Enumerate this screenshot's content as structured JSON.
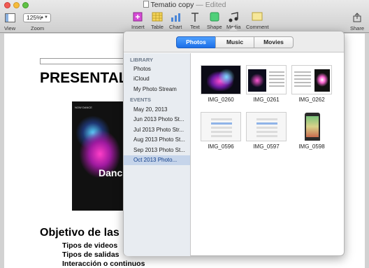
{
  "window": {
    "title": "Tematio copy",
    "status": "Edited",
    "separator": "—"
  },
  "toolbar": {
    "view_label": "View",
    "zoom_value": "125%",
    "zoom_label": "Zoom",
    "items": [
      {
        "label": "Insert",
        "icon": "insert-icon"
      },
      {
        "label": "Table",
        "icon": "table-icon"
      },
      {
        "label": "Chart",
        "icon": "chart-icon"
      },
      {
        "label": "Text",
        "icon": "text-icon"
      },
      {
        "label": "Shape",
        "icon": "shape-icon"
      },
      {
        "label": "Media",
        "icon": "media-icon"
      },
      {
        "label": "Comment",
        "icon": "comment-icon"
      }
    ],
    "share_label": "Share"
  },
  "document": {
    "title": "PRESENTAL",
    "section_title": "Objetivo de las",
    "bullets": [
      "Tipos de videos",
      "Tipos de salidas",
      "Interacción o continuos"
    ],
    "image_word": "Danc",
    "image_brand": "NOW DANCE"
  },
  "media_browser": {
    "tabs": [
      "Photos",
      "Music",
      "Movies"
    ],
    "active_tab": "Photos",
    "sections": [
      {
        "heading": "LIBRARY",
        "items": [
          "Photos",
          "iCloud",
          "My Photo Stream"
        ]
      },
      {
        "heading": "EVENTS",
        "items": [
          "May 20, 2013",
          "Jun 2013 Photo St...",
          "Jul 2013 Photo Str...",
          "Aug 2013 Photo St...",
          "Sep 2013 Photo St...",
          "Oct 2013 Photo..."
        ]
      }
    ],
    "selected_item": "Oct 2013 Photo...",
    "photos": [
      "IMG_0260",
      "IMG_0261",
      "IMG_0262",
      "IMG_0596",
      "IMG_0597",
      "IMG_0598"
    ]
  }
}
